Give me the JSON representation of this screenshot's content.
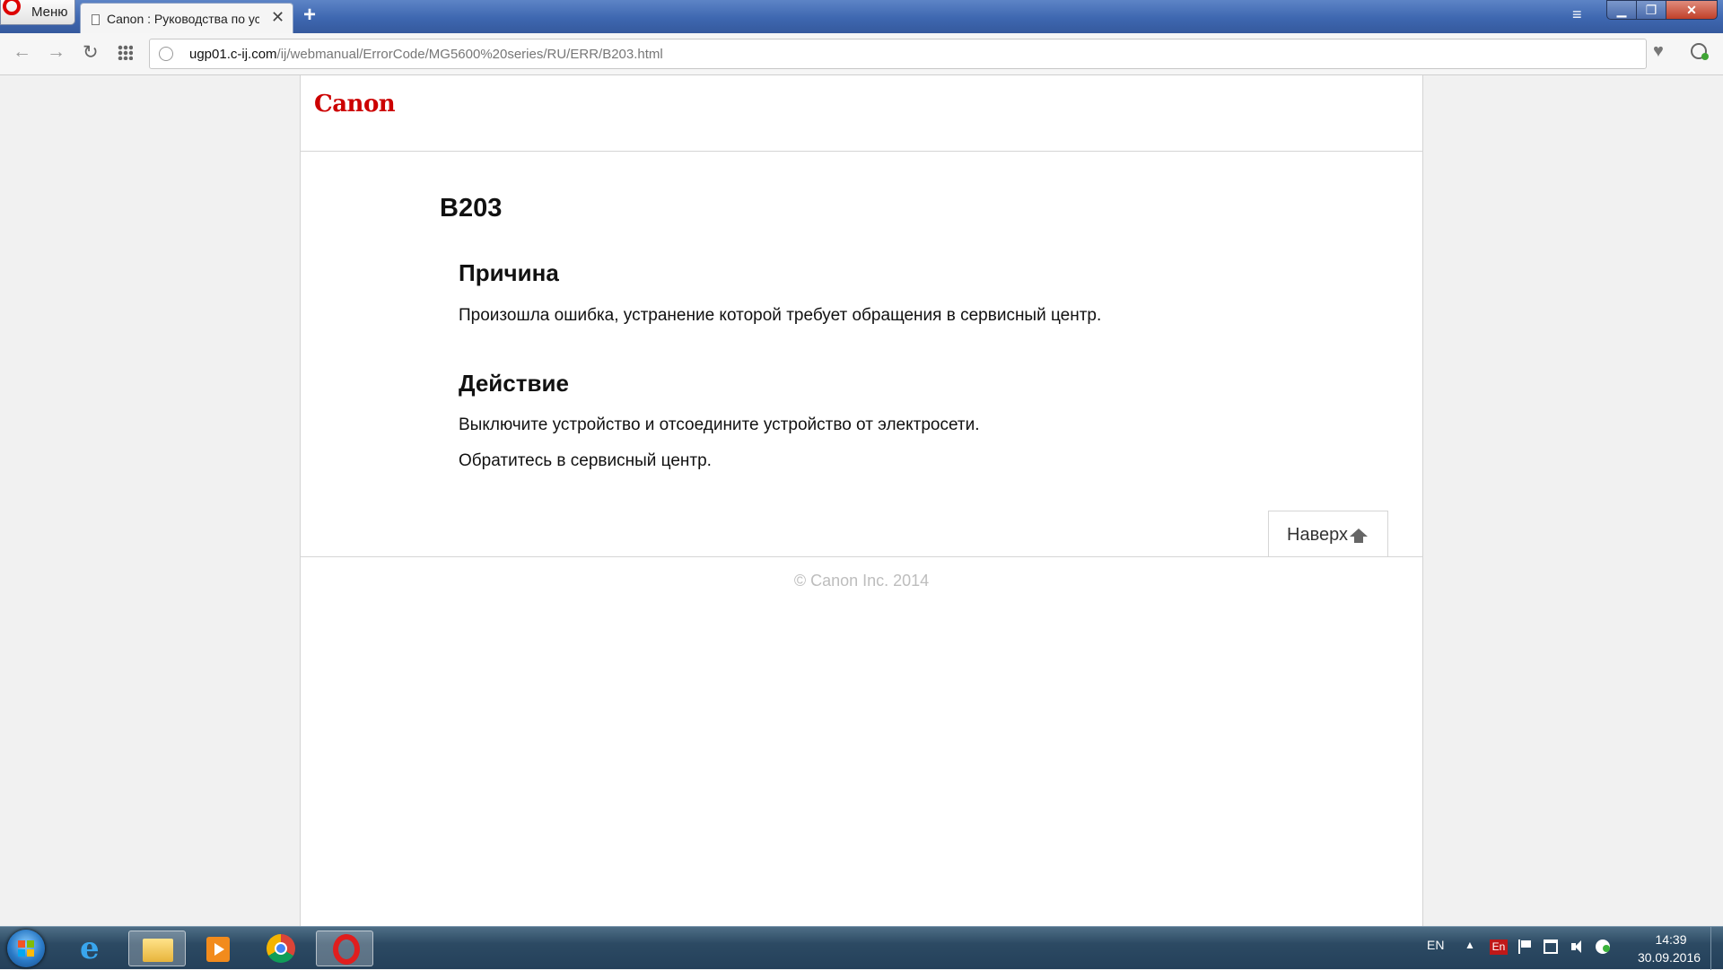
{
  "browser": {
    "menu_label": "Меню",
    "tab_title": "Canon : Руководства по ус",
    "new_tab": "+",
    "address_host": "ugp01.c-ij.com",
    "address_path": "/ij/webmanual/ErrorCode/MG5600%20series/RU/ERR/B203.html"
  },
  "page": {
    "logo": "Canon",
    "error_code": "B203",
    "cause_heading": "Причина",
    "cause_text": "Произошла ошибка, устранение которой требует обращения в сервисный центр.",
    "action_heading": "Действие",
    "action_text_1": "Выключите устройство и отсоедините устройство от электросети.",
    "action_text_2": "Обратитесь в сервисный центр.",
    "to_top_label": "Наверх",
    "copyright": "© Canon Inc. 2014",
    "logo_color": "#cc0000"
  },
  "taskbar": {
    "apps": [
      "internet-explorer",
      "file-explorer",
      "media-player",
      "chrome",
      "opera"
    ],
    "active_app": "opera",
    "lang": "EN",
    "input_indicator": "En",
    "time": "14:39",
    "date": "30.09.2016"
  }
}
